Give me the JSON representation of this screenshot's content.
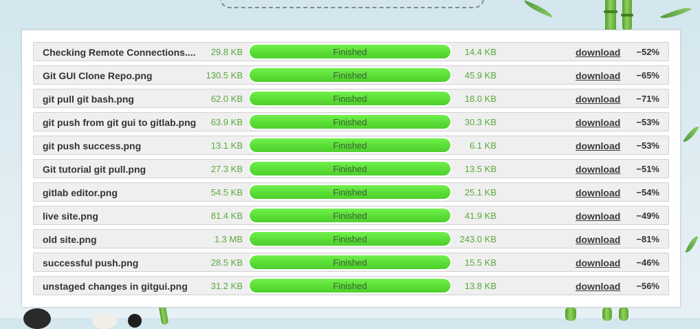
{
  "accent_colors": {
    "progress_fill": "#5ade37",
    "size_text": "#5aa83c",
    "row_background": "#efefef"
  },
  "files": [
    {
      "name": "Checking Remote Connections....",
      "original_size": "29.8 KB",
      "status": "Finished",
      "progress": 1.0,
      "new_size": "14.4 KB",
      "download_label": "download",
      "savings": "−52%"
    },
    {
      "name": "Git GUI Clone Repo.png",
      "original_size": "130.5 KB",
      "status": "Finished",
      "progress": 1.0,
      "new_size": "45.9 KB",
      "download_label": "download",
      "savings": "−65%"
    },
    {
      "name": "git pull git bash.png",
      "original_size": "62.0 KB",
      "status": "Finished",
      "progress": 1.0,
      "new_size": "18.0 KB",
      "download_label": "download",
      "savings": "−71%"
    },
    {
      "name": "git push from git gui to gitlab.png",
      "original_size": "63.9 KB",
      "status": "Finished",
      "progress": 1.0,
      "new_size": "30.3 KB",
      "download_label": "download",
      "savings": "−53%"
    },
    {
      "name": "git push success.png",
      "original_size": "13.1 KB",
      "status": "Finished",
      "progress": 1.0,
      "new_size": "6.1 KB",
      "download_label": "download",
      "savings": "−53%"
    },
    {
      "name": "Git tutorial git pull.png",
      "original_size": "27.3 KB",
      "status": "Finished",
      "progress": 1.0,
      "new_size": "13.5 KB",
      "download_label": "download",
      "savings": "−51%"
    },
    {
      "name": "gitlab editor.png",
      "original_size": "54.5 KB",
      "status": "Finished",
      "progress": 1.0,
      "new_size": "25.1 KB",
      "download_label": "download",
      "savings": "−54%"
    },
    {
      "name": "live site.png",
      "original_size": "81.4 KB",
      "status": "Finished",
      "progress": 1.0,
      "new_size": "41.9 KB",
      "download_label": "download",
      "savings": "−49%"
    },
    {
      "name": "old site.png",
      "original_size": "1.3 MB",
      "status": "Finished",
      "progress": 1.0,
      "new_size": "243.0 KB",
      "download_label": "download",
      "savings": "−81%"
    },
    {
      "name": "successful push.png",
      "original_size": "28.5 KB",
      "status": "Finished",
      "progress": 1.0,
      "new_size": "15.5 KB",
      "download_label": "download",
      "savings": "−46%"
    },
    {
      "name": "unstaged changes in gitgui.png",
      "original_size": "31.2 KB",
      "status": "Finished",
      "progress": 1.0,
      "new_size": "13.8 KB",
      "download_label": "download",
      "savings": "−56%"
    }
  ]
}
